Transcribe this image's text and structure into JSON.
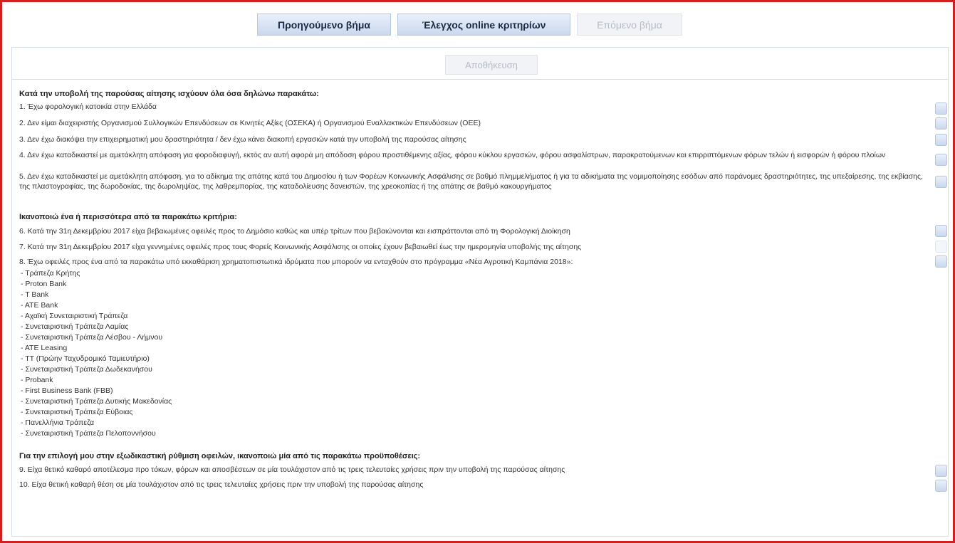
{
  "toolbar": {
    "prev_label": "Προηγούμενο βήμα",
    "check_label": "Έλεγχος online κριτηρίων",
    "next_label": "Επόμενο βήμα"
  },
  "save_label": "Αποθήκευση",
  "section1": {
    "heading": "Κατά την υποβολή της παρούσας αίτησης ισχύουν όλα όσα δηλώνω παρακάτω:",
    "items": [
      "1. Έχω φορολογική κατοικία στην Ελλάδα",
      "2. Δεν είμαι διαχειριστής Οργανισμού Συλλογικών Επενδύσεων σε Κινητές Αξίες (ΟΣΕΚΑ) ή Οργανισμού Εναλλακτικών Επενδύσεων (ΟΕΕ)",
      "3. Δεν έχω διακόψει την επιχειρηματική μου δραστηριότητα / δεν έχω κάνει διακοπή εργασιών κατά την υποβολή της παρούσας αίτησης",
      "4. Δεν έχω καταδικαστεί με αμετάκλητη απόφαση για φοροδιαφυγή, εκτός αν αυτή αφορά μη απόδοση φόρου προστιθέμενης αξίας, φόρου κύκλου εργασιών, φόρου ασφαλίστρων, παρακρατούμενων και επιρριπτόμενων φόρων τελών ή εισφορών ή φόρου πλοίων",
      "5. Δεν έχω καταδικαστεί με αμετάκλητη απόφαση, για το αδίκημα της απάτης κατά του Δημοσίου ή των Φορέων Κοινωνικής Ασφάλισης σε βαθμό πλημμελήματος ή για τα αδικήματα της νομιμοποίησης εσόδων από παράνομες δραστηριότητες, της υπεξαίρεσης, της εκβίασης, της πλαστογραφίας, της δωροδοκίας, της δωροληψίας, της λαθρεμπορίας, της καταδολίευσης δανειστών, της χρεοκοπίας ή της απάτης σε βαθμό κακουργήματος"
    ]
  },
  "section2": {
    "heading": "Ικανοποιώ ένα ή περισσότερα από τα παρακάτω κριτήρια:",
    "items": [
      "6. Κατά την 31η Δεκεμβρίου 2017 είχα βεβαιωμένες οφειλές προς το Δημόσιο καθώς και υπέρ τρίτων που βεβαιώνονται και εισπράττονται από τη Φορολογική Διοίκηση",
      "7. Κατά την 31η Δεκεμβρίου 2017 είχα γεννημένες οφειλές προς τους Φορείς Κοινωνικής Ασφάλισης οι οποίες έχουν βεβαιωθεί έως την ημερομηνία υποβολής της αίτησης",
      "8. Έχω οφειλές προς ένα από τα παρακάτω υπό εκκαθάριση χρηματοπιστωτικά ιδρύματα που μπορούν να ενταχθούν στο πρόγραμμα «Νέα Αγροτική Καμπάνια 2018»:"
    ],
    "banks": [
      "- Τράπεζα Κρήτης",
      "- Proton Bank",
      "- T Bank",
      "- ATE Bank",
      "- Αχαϊκή Συνεταιριστική Τράπεζα",
      "- Συνεταιριστική Τράπεζα Λαμίας",
      "- Συνεταιριστική Τράπεζα Λέσβου - Λήμνου",
      "- ATE Leasing",
      "- TT (Πρώην Ταχυδρομικό Ταμιευτήριο)",
      "- Συνεταιριστική Τράπεζα Δωδεκανήσου",
      "- Probank",
      "- First Business Bank (FBB)",
      "- Συνεταιριστική Τράπεζα Δυτικής Μακεδονίας",
      "- Συνεταιριστική Τράπεζα Εύβοιας",
      "- Πανελλήνια Τράπεζα",
      "- Συνεταιριστική Τράπεζα Πελοποννήσου"
    ]
  },
  "section3": {
    "heading": "Για την επιλογή μου στην εξωδικαστική ρύθμιση οφειλών, ικανοποιώ μία από τις παρακάτω προϋποθέσεις:",
    "items": [
      "9. Είχα θετικό καθαρό αποτέλεσμα προ τόκων, φόρων και αποσβέσεων σε μία τουλάχιστον από τις τρεις τελευταίες χρήσεις πριν την υποβολή της παρούσας αίτησης",
      "10. Είχα θετική καθαρή θέση σε μία τουλάχιστον από τις τρεις τελευταίες χρήσεις πριν την υποβολή της παρούσας αίτησης"
    ]
  }
}
